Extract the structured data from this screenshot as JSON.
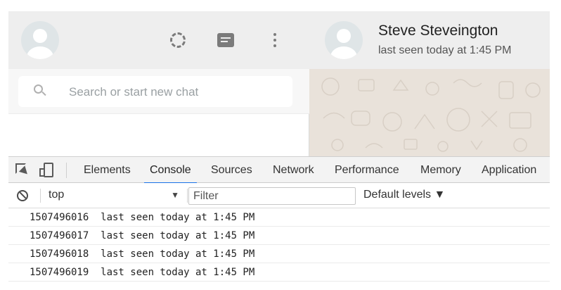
{
  "sidebar": {
    "search": {
      "placeholder": "Search or start new chat"
    },
    "icons": [
      "avatar",
      "status-icon",
      "chat-icon",
      "menu-icon"
    ]
  },
  "chat": {
    "contact_name": "Steve Steveington",
    "last_seen": "last seen today at 1:45 PM"
  },
  "devtools": {
    "tabs": [
      {
        "label": "Elements",
        "active": false
      },
      {
        "label": "Console",
        "active": true
      },
      {
        "label": "Sources",
        "active": false
      },
      {
        "label": "Network",
        "active": false
      },
      {
        "label": "Performance",
        "active": false
      },
      {
        "label": "Memory",
        "active": false
      },
      {
        "label": "Application",
        "active": false
      }
    ],
    "toolbar": {
      "context": "top",
      "filter_placeholder": "Filter",
      "levels_label": "Default levels ▼"
    },
    "logs": [
      "1507496016  last seen today at 1:45 PM",
      "1507496017  last seen today at 1:45 PM",
      "1507496018  last seen today at 1:45 PM",
      "1507496019  last seen today at 1:45 PM"
    ],
    "accent_color": "#1a73e8"
  }
}
